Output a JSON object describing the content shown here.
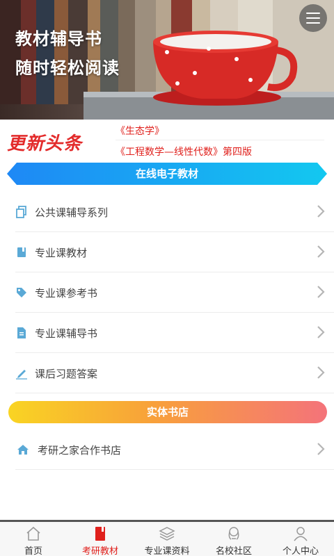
{
  "banner": {
    "line1": "教材辅导书",
    "line2": "随时轻松阅读"
  },
  "headlines": {
    "logo_text": "更新头条",
    "items": [
      "《生态学》",
      "《工程数学—线性代数》第四版"
    ]
  },
  "section_online": {
    "label": "在线电子教材"
  },
  "online_items": [
    {
      "label": "公共课辅导系列",
      "icon": "copy-icon"
    },
    {
      "label": "专业课教材",
      "icon": "book-icon"
    },
    {
      "label": "专业课参考书",
      "icon": "tag-icon"
    },
    {
      "label": "专业课辅导书",
      "icon": "document-icon"
    },
    {
      "label": "课后习题答案",
      "icon": "pencil-icon"
    }
  ],
  "section_store": {
    "label": "实体书店"
  },
  "store_items": [
    {
      "label": "考研之家合作书店",
      "icon": "home-icon"
    }
  ],
  "bottom_nav": [
    {
      "label": "首页",
      "icon": "home-outline-icon",
      "active": false
    },
    {
      "label": "考研教材",
      "icon": "book-icon",
      "active": true
    },
    {
      "label": "专业课资料",
      "icon": "layers-icon",
      "active": false
    },
    {
      "label": "名校社区",
      "icon": "community-icon",
      "active": false
    },
    {
      "label": "个人中心",
      "icon": "person-icon",
      "active": false
    }
  ],
  "colors": {
    "accent_red": "#e0201c",
    "section_blue_start": "#1e88f5",
    "section_blue_end": "#13c8f0",
    "section_orange_start": "#f9d423",
    "section_orange_end": "#f4737a",
    "icon_blue": "#5aa9d6"
  }
}
